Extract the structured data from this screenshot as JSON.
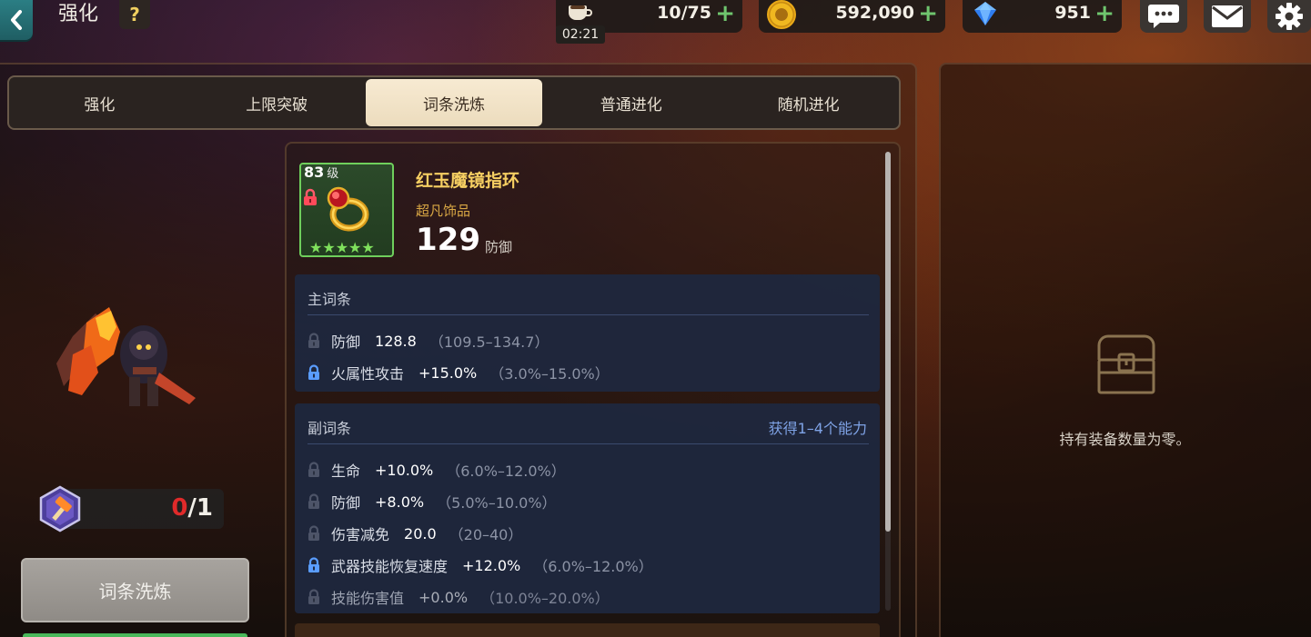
{
  "header": {
    "title": "强化",
    "help_label": "?",
    "back_icon": "chevron-left-icon"
  },
  "resources": {
    "stamina": {
      "value": "10/75",
      "timer": "02:21",
      "icon": "coffee-cup-icon"
    },
    "gold": {
      "value": "592,090",
      "icon": "gold-coin-icon"
    },
    "gems": {
      "value": "951",
      "icon": "blue-gem-icon"
    },
    "plus_label": "+"
  },
  "top_buttons": [
    "chat-icon",
    "mail-icon",
    "gear-icon"
  ],
  "tabs": [
    {
      "label": "强化",
      "active": false
    },
    {
      "label": "上限突破",
      "active": false
    },
    {
      "label": "词条洗炼",
      "active": true
    },
    {
      "label": "普通进化",
      "active": false
    },
    {
      "label": "随机进化",
      "active": false
    }
  ],
  "reroll": {
    "current": "0",
    "max": "/1",
    "button_label": "词条洗炼"
  },
  "item": {
    "level": "83",
    "level_unit": "级",
    "name": "红玉魔镜指环",
    "grade": "超凡饰品",
    "power": "129",
    "power_label": "防御",
    "stars": "★★★★★",
    "star_count": 5,
    "locked": true
  },
  "main_stats": {
    "title": "主词条",
    "rows": [
      {
        "name": "防御",
        "value": "128.8",
        "range": "（109.5–134.7）",
        "locked": false,
        "dim": false
      },
      {
        "name": "火属性攻击",
        "value": "+15.0%",
        "range": "（3.0%–15.0%）",
        "locked": true,
        "dim": false
      }
    ]
  },
  "sub_stats": {
    "title": "副词条",
    "note": "获得1–4个能力",
    "rows": [
      {
        "name": "生命",
        "value": "+10.0%",
        "range": "（6.0%–12.0%）",
        "locked": false,
        "dim": false
      },
      {
        "name": "防御",
        "value": "+8.0%",
        "range": "（5.0%–10.0%）",
        "locked": false,
        "dim": false
      },
      {
        "name": "伤害减免",
        "value": "20.0",
        "range": "（20–40）",
        "locked": false,
        "dim": false
      },
      {
        "name": "武器技能恢复速度",
        "value": "+12.0%",
        "range": "（6.0%–12.0%）",
        "locked": true,
        "dim": false
      },
      {
        "name": "技能伤害值",
        "value": "+0.0%",
        "range": "（10.0%–20.0%）",
        "locked": false,
        "dim": true
      }
    ]
  },
  "inventory": {
    "empty_text": "持有装备数量为零。",
    "icon": "treasure-chest-icon"
  },
  "colors": {
    "accent_gold": "#f6cf62",
    "grade_orange": "#d9a744",
    "lock_active": "#5a9dff",
    "lock_inactive": "#4d5468",
    "count_red": "#e02a2a",
    "star_green": "#7fe05c",
    "plus_green": "#6fc56e"
  }
}
